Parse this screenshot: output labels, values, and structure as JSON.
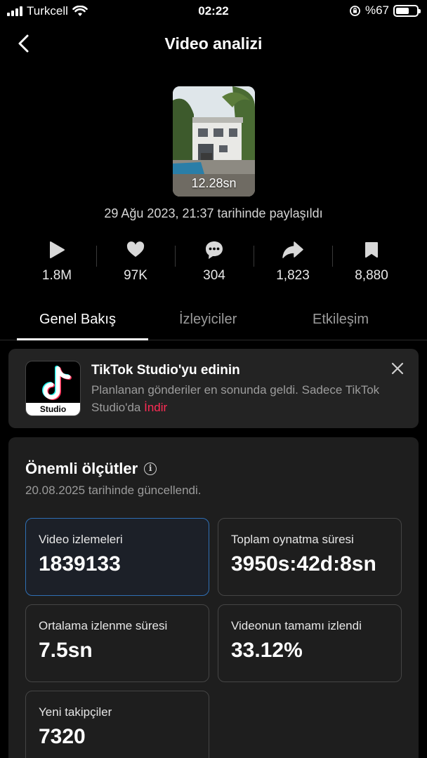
{
  "status_bar": {
    "carrier": "Turkcell",
    "time": "02:22",
    "battery": "%67"
  },
  "header": {
    "title": "Video analizi"
  },
  "video": {
    "duration": "12.28sn",
    "shared_text": "29 Ağu 2023, 21:37 tarihinde paylaşıldı"
  },
  "stats": [
    {
      "icon": "play-icon",
      "value": "1.8M"
    },
    {
      "icon": "heart-icon",
      "value": "97K"
    },
    {
      "icon": "comment-icon",
      "value": "304"
    },
    {
      "icon": "share-icon",
      "value": "1,823"
    },
    {
      "icon": "bookmark-icon",
      "value": "8,880"
    }
  ],
  "tabs": [
    {
      "label": "Genel Bakış",
      "active": true
    },
    {
      "label": "İzleyiciler",
      "active": false
    },
    {
      "label": "Etkileşim",
      "active": false
    }
  ],
  "promo": {
    "logo_text": "Studio",
    "title": "TikTok Studio'yu edinin",
    "body": "Planlanan gönderiler en sonunda geldi. Sadece TikTok Studio'da",
    "link": "İndir"
  },
  "metrics": {
    "title": "Önemli ölçütler",
    "updated": "20.08.2025 tarihinde güncellendi.",
    "cards": [
      {
        "label": "Video izlemeleri",
        "value": "1839133",
        "selected": true
      },
      {
        "label": "Toplam oynatma süresi",
        "value": "3950s:42d:8sn",
        "selected": false
      },
      {
        "label": "Ortalama izlenme süresi",
        "value": "7.5sn",
        "selected": false
      },
      {
        "label": "Videonun tamamı izlendi",
        "value": "33.12%",
        "selected": false
      },
      {
        "label": "Yeni takipçiler",
        "value": "7320",
        "selected": false
      }
    ]
  },
  "colors": {
    "accent_link": "#fe2c55",
    "selected_border": "#2f6fb4",
    "background": "#000000",
    "card_background": "#1e1e1e"
  }
}
